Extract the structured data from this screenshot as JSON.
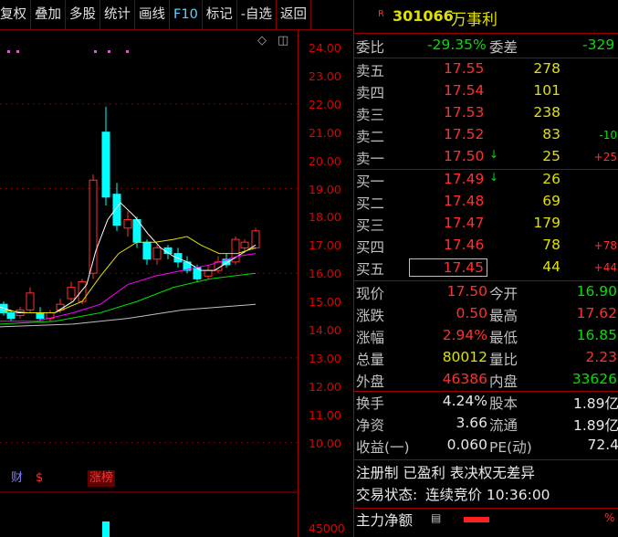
{
  "toolbar": {
    "buttons": [
      "复权",
      "叠加",
      "多股",
      "统计",
      "画线",
      "F10",
      "标记",
      "-自选",
      "返回"
    ]
  },
  "chart": {
    "price_ticks": [
      "24.00",
      "23.00",
      "22.00",
      "21.00",
      "20.00",
      "19.00",
      "18.00",
      "17.00",
      "16.00",
      "15.00",
      "14.00",
      "13.00",
      "12.00",
      "11.00",
      "10.00"
    ],
    "volume_tick": "45000",
    "markers": {
      "cai": "财",
      "s": "$",
      "zhangbang": "涨榜"
    },
    "controls": {
      "diamond": "◇",
      "toggle": "◫"
    },
    "colors": {
      "up": "#ff3030",
      "down": "#00ffff",
      "ma5": "#ffffff",
      "ma10": "#e0e000",
      "ma20": "#ff00ff",
      "ma60": "#00e000"
    }
  },
  "quote": {
    "badge": "R",
    "code": "301066",
    "name": "万事利",
    "weibi_label": "委比",
    "weibi_value": "-29.35%",
    "weicha_label": "委差",
    "weicha_value": "-329",
    "asks": [
      {
        "label": "卖五",
        "price": "17.55",
        "vol": "278",
        "chg": "",
        "arrow": ""
      },
      {
        "label": "卖四",
        "price": "17.54",
        "vol": "101",
        "chg": "",
        "arrow": ""
      },
      {
        "label": "卖三",
        "price": "17.53",
        "vol": "238",
        "chg": "",
        "arrow": ""
      },
      {
        "label": "卖二",
        "price": "17.52",
        "vol": "83",
        "chg": "-10",
        "arrow": ""
      },
      {
        "label": "卖一",
        "price": "17.50",
        "vol": "25",
        "chg": "+25",
        "arrow": "↓"
      }
    ],
    "bids": [
      {
        "label": "买一",
        "price": "17.49",
        "vol": "26",
        "chg": "",
        "arrow": "↓"
      },
      {
        "label": "买二",
        "price": "17.48",
        "vol": "69",
        "chg": "",
        "arrow": ""
      },
      {
        "label": "买三",
        "price": "17.47",
        "vol": "179",
        "chg": "",
        "arrow": ""
      },
      {
        "label": "买四",
        "price": "17.46",
        "vol": "78",
        "chg": "+78",
        "arrow": ""
      },
      {
        "label": "买五",
        "price": "17.45",
        "vol": "44",
        "chg": "+44",
        "arrow": ""
      }
    ],
    "stats": [
      {
        "l1": "现价",
        "v1": "17.50",
        "c1": "red",
        "l2": "今开",
        "v2": "16.90",
        "c2": "green"
      },
      {
        "l1": "涨跌",
        "v1": "0.50",
        "c1": "red",
        "l2": "最高",
        "v2": "17.62",
        "c2": "red"
      },
      {
        "l1": "涨幅",
        "v1": "2.94%",
        "c1": "red",
        "l2": "最低",
        "v2": "16.85",
        "c2": "green"
      },
      {
        "l1": "总量",
        "v1": "80012",
        "c1": "yellow",
        "l2": "量比",
        "v2": "2.23",
        "c2": "red"
      },
      {
        "l1": "外盘",
        "v1": "46386",
        "c1": "red",
        "l2": "内盘",
        "v2": "33626",
        "c2": "green"
      }
    ],
    "fin": [
      {
        "l1": "换手",
        "v1": "4.24%",
        "l2": "股本",
        "v2": "1.89亿"
      },
      {
        "l1": "净资",
        "v1": "3.66",
        "l2": "流通",
        "v2": "1.89亿"
      },
      {
        "l1": "收益(一)",
        "v1": "0.060",
        "l2": "PE(动)",
        "v2": "72.4"
      }
    ],
    "tags": "注册制 已盈利 表决权无差异",
    "status_label": "交易状态:",
    "status_value": "连续竞价 10:36:00",
    "main_flow_label": "主力净额",
    "main_flow_pct": "%"
  }
}
